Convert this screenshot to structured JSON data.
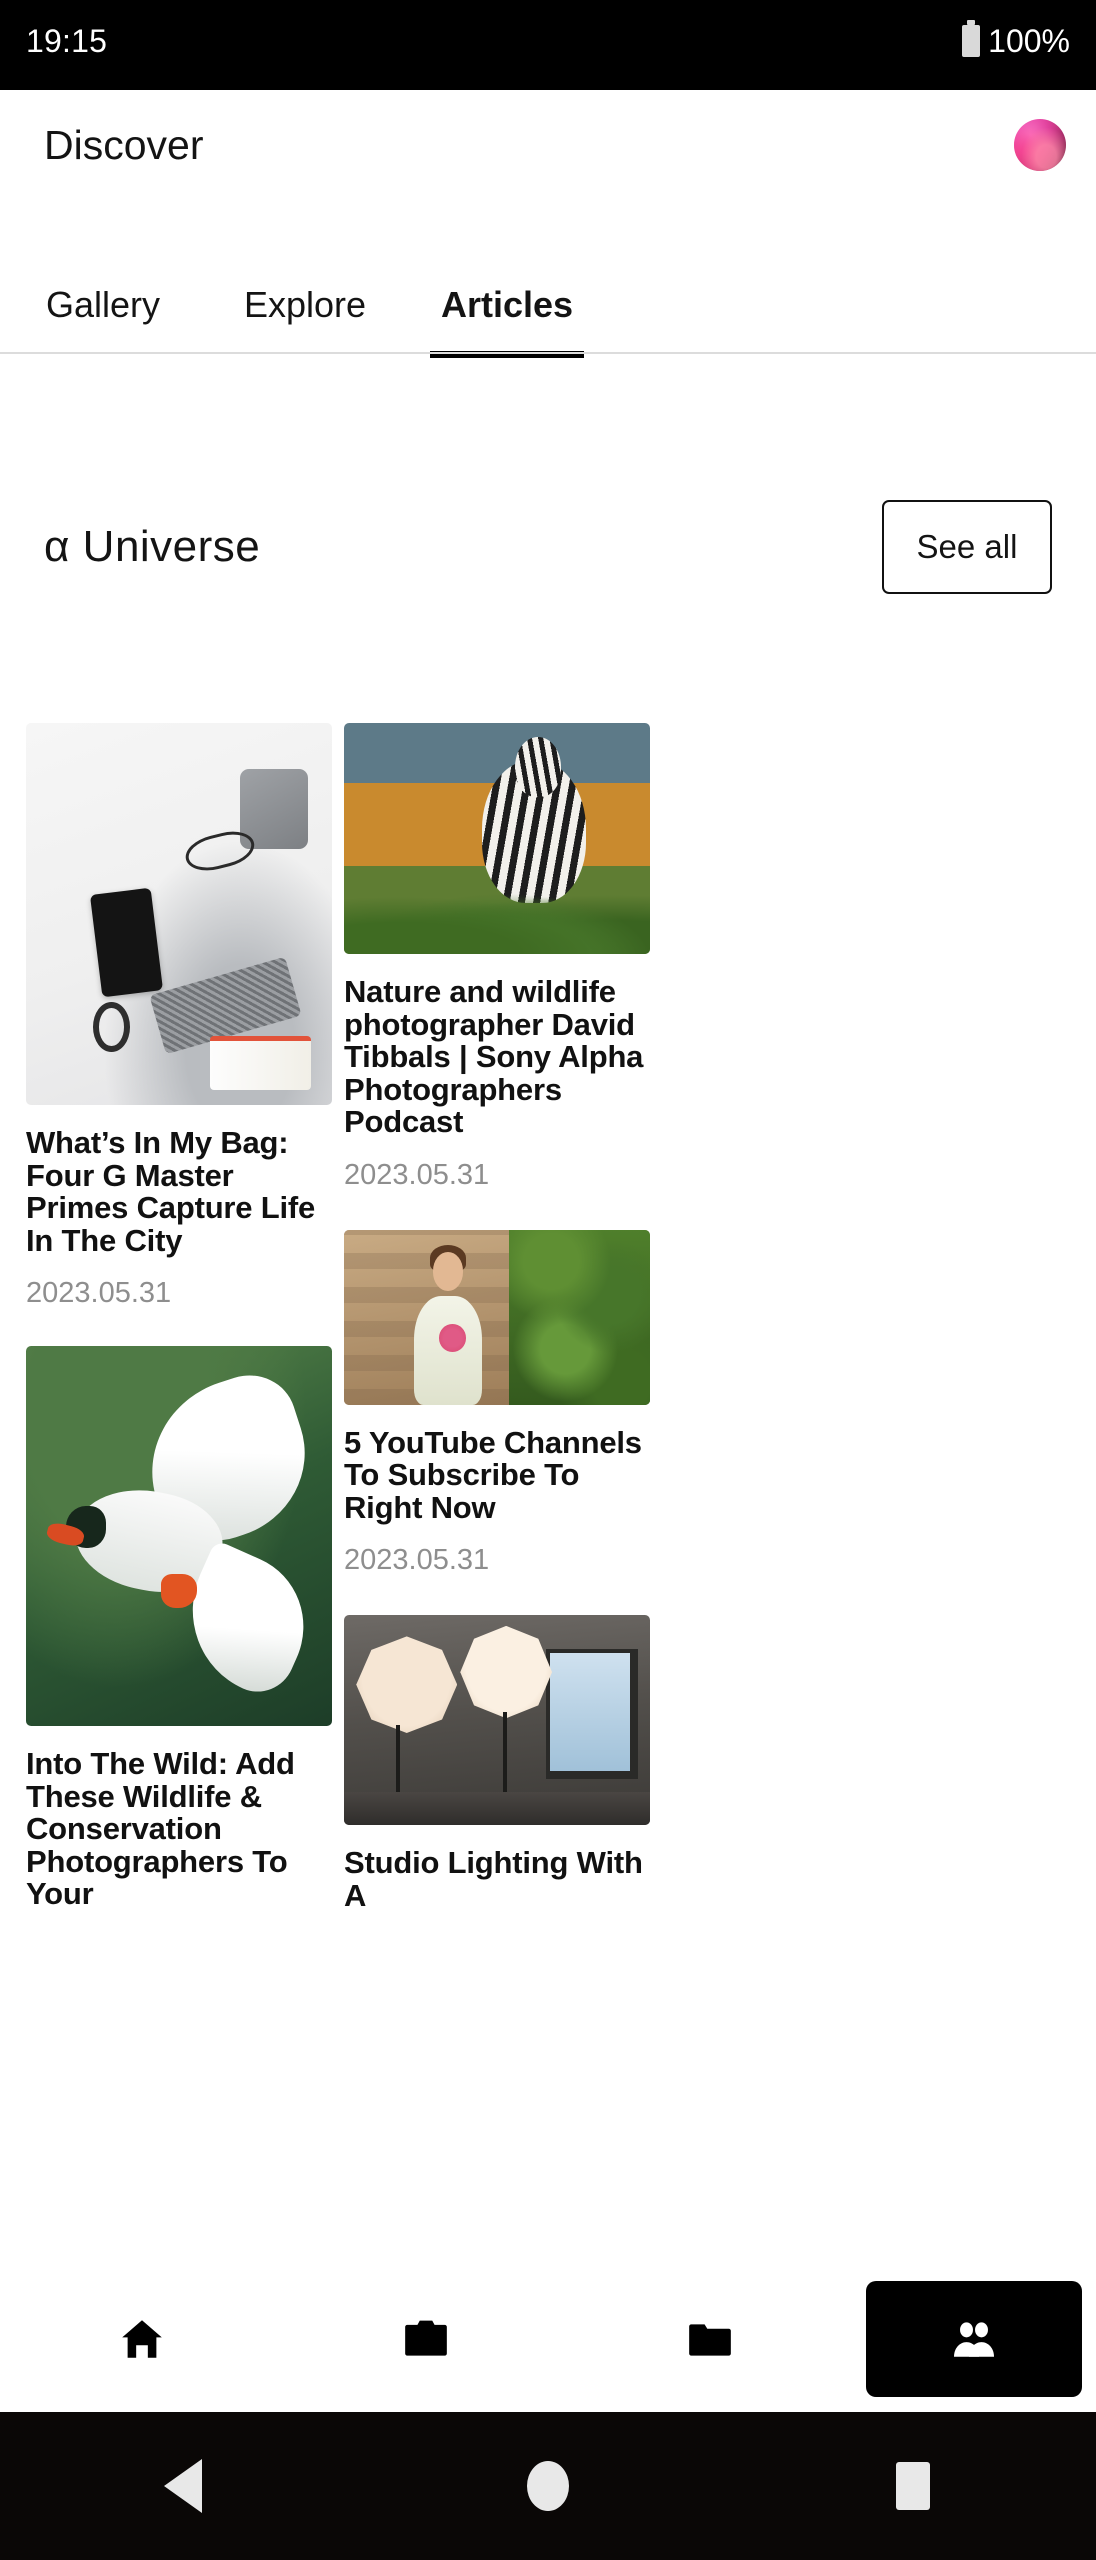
{
  "status_bar": {
    "time": "19:15",
    "battery_percent": "100%",
    "battery_icon": "battery-full-icon"
  },
  "app_bar": {
    "title": "Discover",
    "avatar_icon": "user-avatar"
  },
  "tabs": [
    {
      "label": "Gallery",
      "active": false
    },
    {
      "label": "Explore",
      "active": false
    },
    {
      "label": "Articles",
      "active": true
    }
  ],
  "section": {
    "title": "α Universe",
    "see_all_label": "See all"
  },
  "articles": {
    "left_column": [
      {
        "title": "What’s In My Bag: Four G Master Primes Capture Life In The City",
        "date": "2023.05.31",
        "thumb": "flat-lay-camera-bag-photo"
      },
      {
        "title": "Into The Wild: Add These Wildlife & Conservation Photographers To Your",
        "date": "",
        "thumb": "white-tern-bird-in-flight-photo"
      }
    ],
    "right_column": [
      {
        "title": "Nature and wildlife photographer David Tibbals | Sony Alpha Photographers Podcast",
        "date": "2023.05.31",
        "thumb": "zebra-in-savanna-photo"
      },
      {
        "title": "5 YouTube Channels To Subscribe To Right Now",
        "date": "2023.05.31",
        "thumb": "bride-by-ivy-wall-photo"
      },
      {
        "title": "Studio Lighting With A",
        "date": "",
        "thumb": "studio-lighting-umbrellas-photo"
      }
    ]
  },
  "bottom_nav": [
    {
      "icon": "home-icon",
      "active": false
    },
    {
      "icon": "camera-icon",
      "active": false
    },
    {
      "icon": "folder-icon",
      "active": false
    },
    {
      "icon": "people-icon",
      "active": true
    }
  ],
  "system_nav": [
    {
      "icon": "back-triangle-icon"
    },
    {
      "icon": "home-circle-icon"
    },
    {
      "icon": "recents-square-icon"
    }
  ],
  "colors": {
    "accent": "#000000",
    "text_primary": "#111111",
    "text_muted": "#8e8e8e",
    "background": "#ffffff",
    "status_bar_bg": "#000000",
    "system_nav_bg": "#0a0706"
  }
}
